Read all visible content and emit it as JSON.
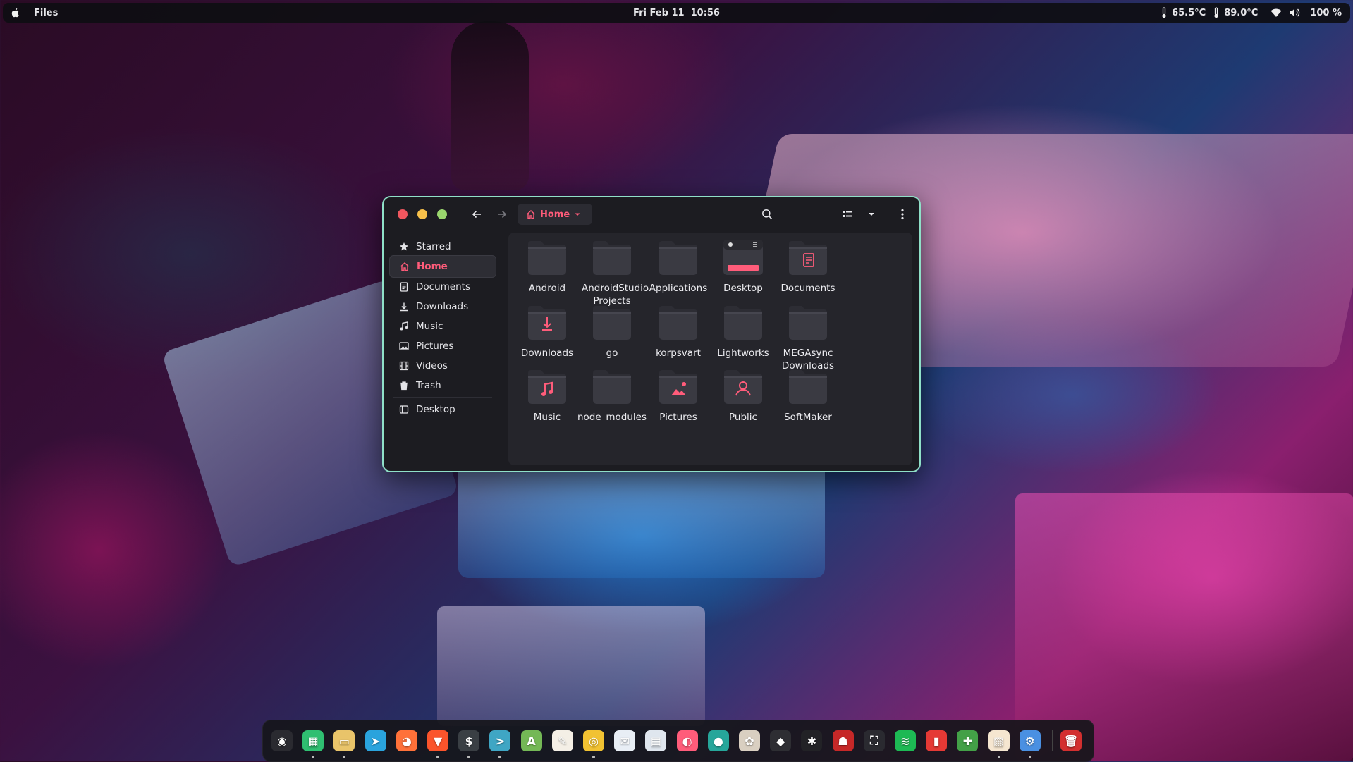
{
  "topbar": {
    "app_name": "Files",
    "datetime": "Fri Feb 11  10:56",
    "cpu_temp": "65.5°C",
    "gpu_temp": "89.0°C",
    "battery": "100 %"
  },
  "window": {
    "location": "Home",
    "sidebar": {
      "items": [
        {
          "label": "Starred",
          "icon": "star-icon"
        },
        {
          "label": "Home",
          "icon": "home-icon"
        },
        {
          "label": "Documents",
          "icon": "document-icon"
        },
        {
          "label": "Downloads",
          "icon": "download-icon"
        },
        {
          "label": "Music",
          "icon": "music-icon"
        },
        {
          "label": "Pictures",
          "icon": "picture-icon"
        },
        {
          "label": "Videos",
          "icon": "video-icon"
        },
        {
          "label": "Trash",
          "icon": "trash-icon"
        },
        {
          "label": "Desktop",
          "icon": "drive-icon"
        }
      ]
    },
    "folders": [
      {
        "name": "Android",
        "emblem": ""
      },
      {
        "name": "AndroidStudio Projects",
        "emblem": ""
      },
      {
        "name": "Applications",
        "emblem": ""
      },
      {
        "name": "Desktop",
        "emblem": "desktop"
      },
      {
        "name": "Documents",
        "emblem": "document"
      },
      {
        "name": "Downloads",
        "emblem": "download"
      },
      {
        "name": "go",
        "emblem": ""
      },
      {
        "name": "korpsvart",
        "emblem": ""
      },
      {
        "name": "Lightworks",
        "emblem": ""
      },
      {
        "name": "MEGAsync Downloads",
        "emblem": ""
      },
      {
        "name": "Music",
        "emblem": "music"
      },
      {
        "name": "node_modules",
        "emblem": ""
      },
      {
        "name": "Pictures",
        "emblem": "picture"
      },
      {
        "name": "Public",
        "emblem": "user"
      },
      {
        "name": "SoftMaker",
        "emblem": ""
      }
    ]
  },
  "colors": {
    "accent": "#ff5c7a",
    "window_border": "#8fe0c8",
    "folder": "#3a3a42",
    "close": "#f0575f",
    "minimize": "#f7c04a",
    "maximize": "#9ad66e"
  },
  "dock": {
    "apps": [
      {
        "name": "activities-app-icon",
        "color": "#2a2a30",
        "glyph": "◉",
        "running": false
      },
      {
        "name": "spreadsheet-app-icon",
        "color": "#2fbf71",
        "glyph": "▦",
        "running": true
      },
      {
        "name": "files-app-icon",
        "color": "#e9c46a",
        "glyph": "▭",
        "running": true
      },
      {
        "name": "telegram-app-icon",
        "color": "#2aa3dd",
        "glyph": "➤",
        "running": false
      },
      {
        "name": "firefox-app-icon",
        "color": "#ff7139",
        "glyph": "◕",
        "running": false
      },
      {
        "name": "brave-app-icon",
        "color": "#fb542b",
        "glyph": "▼",
        "running": true
      },
      {
        "name": "terminal-app-icon",
        "color": "#3a3f44",
        "glyph": "$",
        "running": true
      },
      {
        "name": "console-app-icon",
        "color": "#3fa6c4",
        "glyph": ">",
        "running": true
      },
      {
        "name": "android-studio-app-icon",
        "color": "#74b856",
        "glyph": "A",
        "running": false
      },
      {
        "name": "text-editor-app-icon",
        "color": "#f4efe6",
        "glyph": "✎",
        "running": false
      },
      {
        "name": "chrome-app-icon",
        "color": "#f1c232",
        "glyph": "◎",
        "running": true
      },
      {
        "name": "mail-app-icon",
        "color": "#e8eef5",
        "glyph": "✉",
        "running": false
      },
      {
        "name": "card-app-icon",
        "color": "#dfe6ee",
        "glyph": "▤",
        "running": false
      },
      {
        "name": "color-picker-app-icon",
        "color": "#ff5c7a",
        "glyph": "◐",
        "running": false
      },
      {
        "name": "screen-recorder-app-icon",
        "color": "#26a69a",
        "glyph": "●",
        "running": false
      },
      {
        "name": "gimp-app-icon",
        "color": "#d9cfc1",
        "glyph": "✿",
        "running": false
      },
      {
        "name": "github-app-icon",
        "color": "#2e2e33",
        "glyph": "◆",
        "running": false
      },
      {
        "name": "figma-app-icon",
        "color": "#222226",
        "glyph": "✱",
        "running": false
      },
      {
        "name": "game-app-icon",
        "color": "#c62828",
        "glyph": "☗",
        "running": false
      },
      {
        "name": "screenshot-app-icon",
        "color": "#2a2a30",
        "glyph": "⛶",
        "running": false
      },
      {
        "name": "spotify-app-icon",
        "color": "#1db954",
        "glyph": "≋",
        "running": false
      },
      {
        "name": "audio-app-icon",
        "color": "#e53935",
        "glyph": "▮",
        "running": false
      },
      {
        "name": "extensions-app-icon",
        "color": "#43a047",
        "glyph": "✚",
        "running": false
      },
      {
        "name": "tweaks-app-icon",
        "color": "#f5e6d0",
        "glyph": "▧",
        "running": true
      },
      {
        "name": "settings-app-icon",
        "color": "#4a90e2",
        "glyph": "⚙",
        "running": true
      },
      {
        "name": "trash-app-icon",
        "color": "#d32f2f",
        "glyph": "🗑",
        "running": false
      }
    ]
  }
}
